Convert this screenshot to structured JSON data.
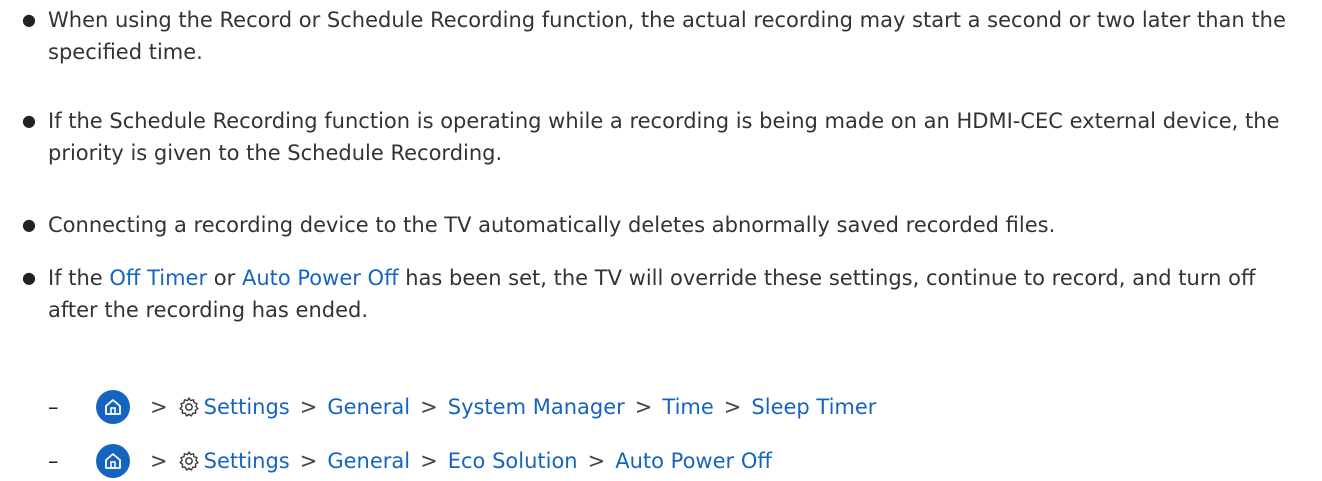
{
  "bullets": [
    {
      "text": "When using the Record or Schedule Recording function, the actual recording may start a second or two later than the specified time."
    },
    {
      "text": "If the Schedule Recording function is operating while a recording is being made on an HDMI-CEC external device, the priority is given to the Schedule Recording."
    },
    {
      "text": "Connecting a recording device to the TV automatically deletes abnormally saved recorded files."
    },
    {
      "prefix": "If the ",
      "link1": "Off Timer",
      "middle": " or ",
      "link2": "Auto Power Off",
      "suffix": " has been set, the TV will override these settings, continue to record, and turn off after the recording has ended."
    }
  ],
  "bullet_symbol": "●",
  "dash_symbol": "–",
  "separator": ">",
  "paths": [
    {
      "home_icon": "home-icon",
      "settings_icon": "gear-icon",
      "items": [
        "Settings",
        "General",
        "System Manager",
        "Time",
        "Sleep Timer"
      ]
    },
    {
      "home_icon": "home-icon",
      "settings_icon": "gear-icon",
      "items": [
        "Settings",
        "General",
        "Eco Solution",
        "Auto Power Off"
      ]
    }
  ],
  "colors": {
    "link": "#1565c0",
    "text": "#333333"
  }
}
